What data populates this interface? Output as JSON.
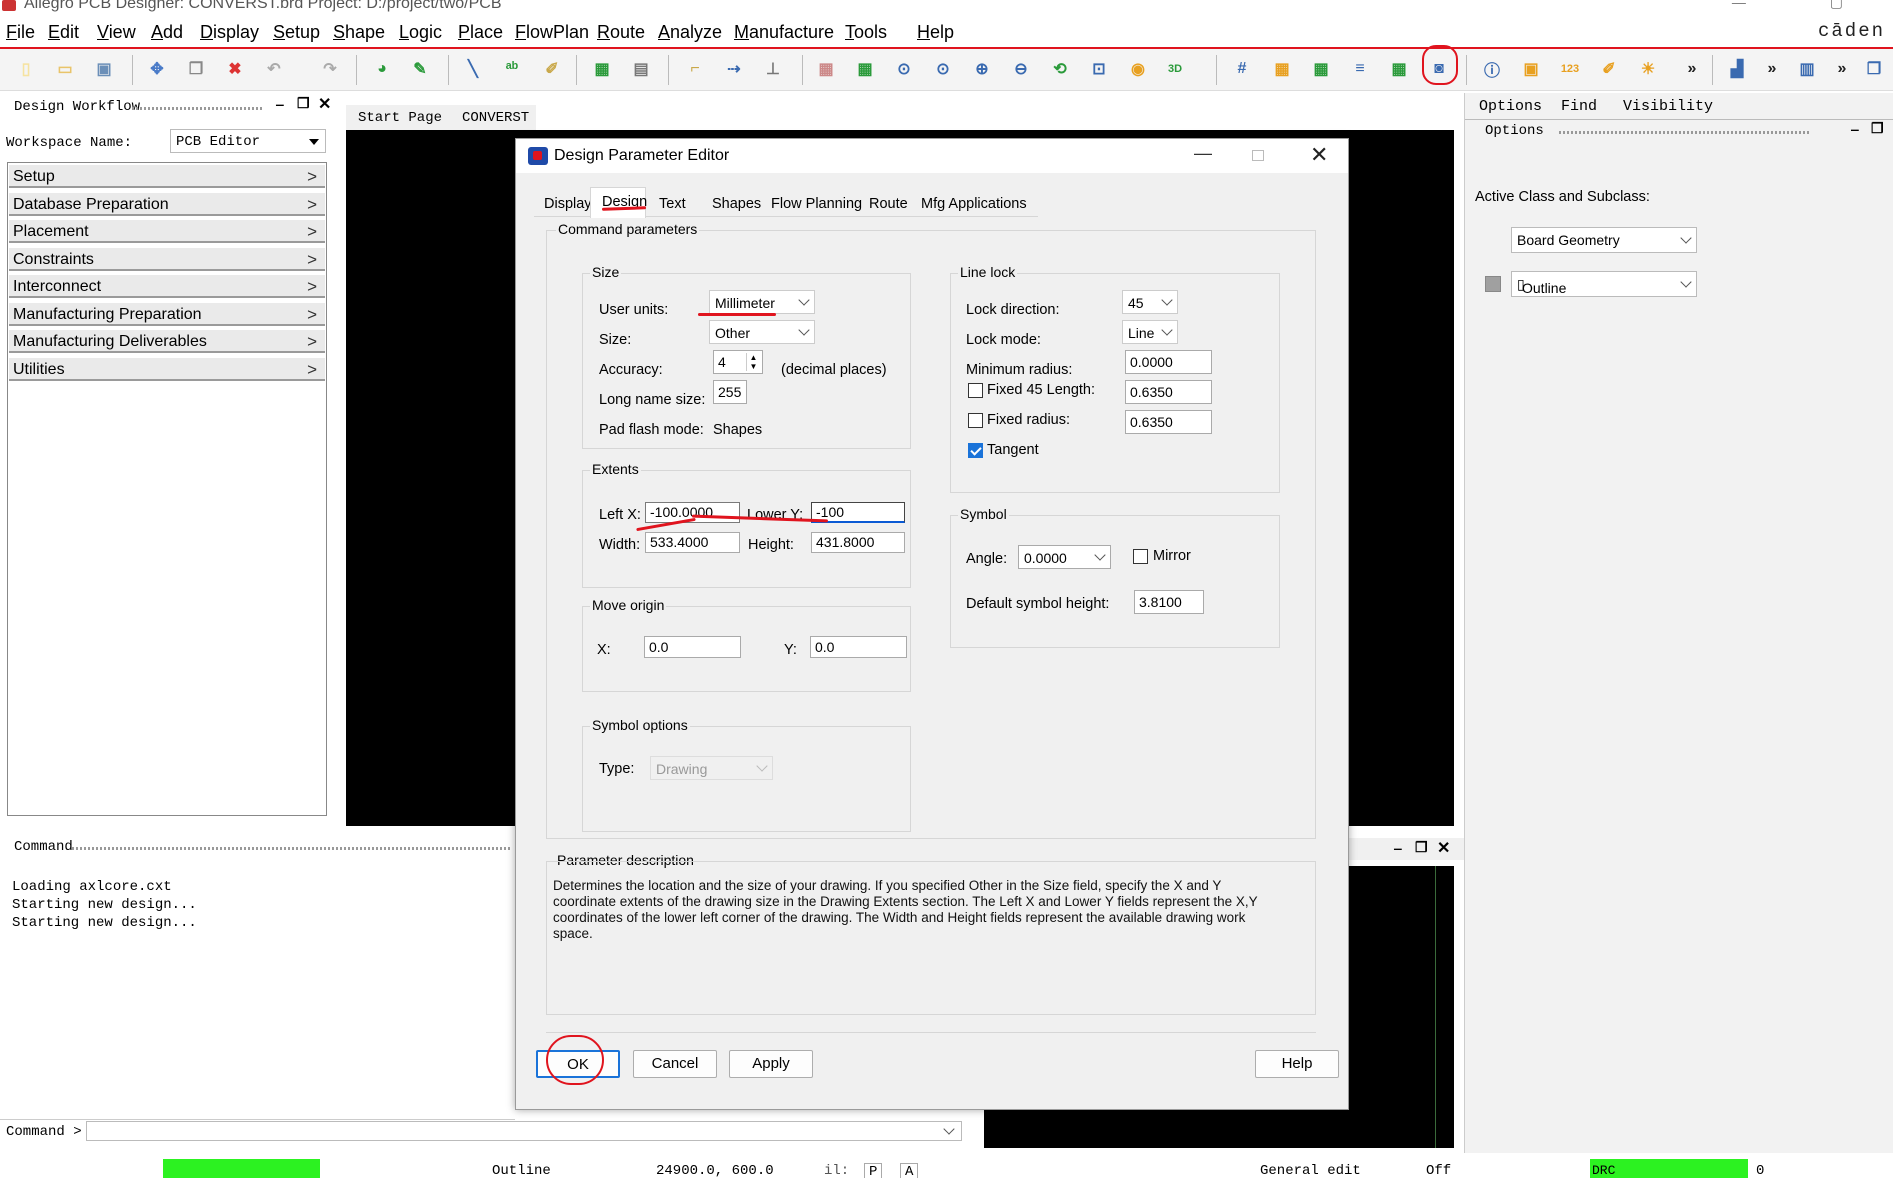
{
  "window": {
    "title": "Allegro PCB Designer: CONVERST.brd  Project: D:/project/two/PCB"
  },
  "brand": "cāden",
  "menu": [
    {
      "label": "File",
      "u": "F",
      "rest": "ile"
    },
    {
      "label": "Edit",
      "u": "E",
      "rest": "dit"
    },
    {
      "label": "View",
      "u": "V",
      "rest": "iew"
    },
    {
      "label": "Add",
      "u": "A",
      "rest": "dd"
    },
    {
      "label": "Display",
      "u": "D",
      "rest": "isplay"
    },
    {
      "label": "Setup",
      "u": "S",
      "rest": "etup"
    },
    {
      "label": "Shape",
      "u": "S",
      "rest": "hape"
    },
    {
      "label": "Logic",
      "u": "L",
      "rest": "ogic"
    },
    {
      "label": "Place",
      "u": "P",
      "rest": "lace"
    },
    {
      "label": "FlowPlan",
      "u": "F",
      "rest": "lowPlan"
    },
    {
      "label": "Route",
      "u": "R",
      "rest": "oute"
    },
    {
      "label": "Analyze",
      "u": "A",
      "rest": "nalyze"
    },
    {
      "label": "Manufacture",
      "u": "M",
      "rest": "anufacture"
    },
    {
      "label": "Tools",
      "u": "T",
      "rest": "ools"
    },
    {
      "label": "Help",
      "u": "H",
      "rest": "elp"
    }
  ],
  "toolbar": {
    "overflow": "»",
    "threeD": "3D"
  },
  "design_workflow": {
    "title": "Design Workflow",
    "workspace_label": "Workspace Name:",
    "workspace_value": "PCB Editor",
    "items": [
      "Setup",
      "Database Preparation",
      "Placement",
      "Constraints",
      "Interconnect",
      "Manufacturing Preparation",
      "Manufacturing Deliverables",
      "Utilities"
    ]
  },
  "center_tabs": [
    "Start Page",
    "CONVERST"
  ],
  "right_panel": {
    "tabs": [
      "Options",
      "Find",
      "Visibility"
    ],
    "subtitle": "Options",
    "active_class_label": "Active Class and Subclass:",
    "class_value": "Board Geometry",
    "subclass_value": "Outline"
  },
  "command": {
    "title": "Command",
    "log": "Loading axlcore.cxt\nStarting new design...\nStarting new design...",
    "prompt": "Command >"
  },
  "status": {
    "outline": "Outline",
    "coords": "24900.0, 600.0",
    "il": "il:",
    "p": "P",
    "a": "A",
    "mode": "General edit",
    "off": "Off",
    "drc": "DRC",
    "drc_count": "0"
  },
  "dialog": {
    "title": "Design Parameter Editor",
    "tabs": [
      "Display",
      "Design",
      "Text",
      "Shapes",
      "Flow Planning",
      "Route",
      "Mfg Applications"
    ],
    "active_tab": "Design",
    "command_parameters": "Command parameters",
    "size": {
      "title": "Size",
      "user_units_label": "User units:",
      "user_units": "Millimeter",
      "size_label": "Size:",
      "size": "Other",
      "accuracy_label": "Accuracy:",
      "accuracy": "4",
      "accuracy_unit": "(decimal places)",
      "long_name_label": "Long name size:",
      "long_name": "255",
      "pad_flash_label": "Pad flash mode:",
      "pad_flash": "Shapes"
    },
    "extents": {
      "title": "Extents",
      "left_x_label": "Left X:",
      "left_x": "-100.0000",
      "lower_y_label": "Lower Y:",
      "lower_y": "-100",
      "width_label": "Width:",
      "width": "533.4000",
      "height_label": "Height:",
      "height": "431.8000"
    },
    "move_origin": {
      "title": "Move origin",
      "x_label": "X:",
      "x": "0.0",
      "y_label": "Y:",
      "y": "0.0"
    },
    "symbol_options": {
      "title": "Symbol options",
      "type_label": "Type:",
      "type": "Drawing"
    },
    "line_lock": {
      "title": "Line lock",
      "lock_direction_label": "Lock direction:",
      "lock_direction": "45",
      "lock_mode_label": "Lock mode:",
      "lock_mode": "Line",
      "min_radius_label": "Minimum radius:",
      "min_radius": "0.0000",
      "fixed45_label": "Fixed 45 Length:",
      "fixed45": "0.6350",
      "fixed45_checked": false,
      "fixed_radius_label": "Fixed radius:",
      "fixed_radius": "0.6350",
      "fixed_radius_checked": false,
      "tangent_label": "Tangent",
      "tangent_checked": true
    },
    "symbol": {
      "title": "Symbol",
      "angle_label": "Angle:",
      "angle": "0.0000",
      "mirror_label": "Mirror",
      "mirror_checked": false,
      "default_height_label": "Default symbol height:",
      "default_height": "3.8100"
    },
    "description": {
      "title": "Parameter description",
      "text": "Determines the location and the size of your drawing. If you specified Other in the Size field, specify the X and Y coordinate extents of the drawing size in the Drawing Extents section. The Left X and Lower Y fields represent the X,Y coordinates of the lower left corner of the drawing. The Width and Height fields represent the available drawing work space."
    },
    "buttons": {
      "ok": "OK",
      "cancel": "Cancel",
      "apply": "Apply",
      "help": "Help"
    }
  },
  "colors": {
    "accent_red": "#e0141e",
    "drc_green": "#2cf221",
    "checkbox_blue": "#1a73d9"
  }
}
